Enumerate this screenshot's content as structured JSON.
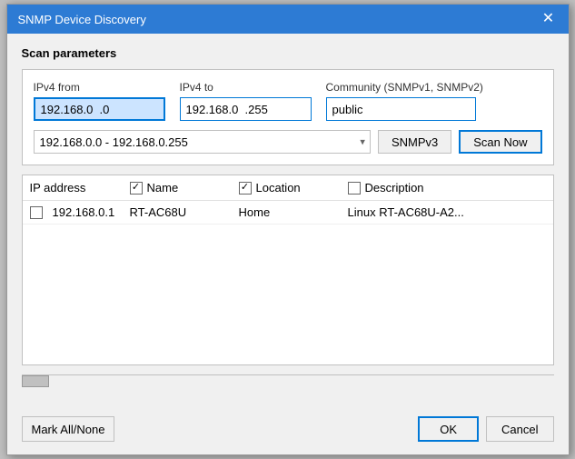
{
  "dialog": {
    "title": "SNMP Device Discovery",
    "close_label": "✕"
  },
  "scan_params": {
    "section_label": "Scan parameters",
    "ipv4_from_label": "IPv4 from",
    "ipv4_from_value": "192.168.0  .0",
    "ipv4_to_label": "IPv4 to",
    "ipv4_to_value": "192.168.0  .255",
    "community_label": "Community (SNMPv1, SNMPv2)",
    "community_value": "public",
    "range_value": "192.168.0.0 - 192.168.0.255",
    "snmpv3_label": "SNMPv3",
    "scan_now_label": "Scan Now"
  },
  "table": {
    "col_ip": "IP address",
    "col_name": "Name",
    "col_location": "Location",
    "col_description": "Description",
    "name_checked": true,
    "location_checked": true,
    "description_checked": false,
    "rows": [
      {
        "checked": false,
        "ip": "192.168.0.1",
        "name": "RT-AC68U",
        "location": "Home",
        "description": "Linux RT-AC68U-A2..."
      }
    ]
  },
  "footer": {
    "mark_all_none_label": "Mark All/None",
    "ok_label": "OK",
    "cancel_label": "Cancel"
  }
}
